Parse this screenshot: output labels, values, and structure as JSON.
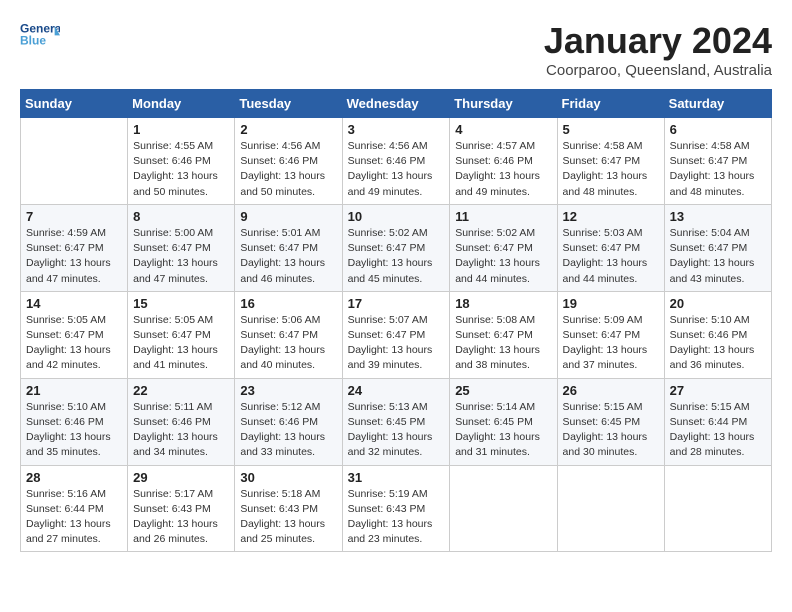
{
  "logo": {
    "general": "General",
    "blue": "Blue"
  },
  "title": "January 2024",
  "location": "Coorparoo, Queensland, Australia",
  "weekdays": [
    "Sunday",
    "Monday",
    "Tuesday",
    "Wednesday",
    "Thursday",
    "Friday",
    "Saturday"
  ],
  "weeks": [
    [
      {
        "day": "",
        "info": ""
      },
      {
        "day": "1",
        "info": "Sunrise: 4:55 AM\nSunset: 6:46 PM\nDaylight: 13 hours\nand 50 minutes."
      },
      {
        "day": "2",
        "info": "Sunrise: 4:56 AM\nSunset: 6:46 PM\nDaylight: 13 hours\nand 50 minutes."
      },
      {
        "day": "3",
        "info": "Sunrise: 4:56 AM\nSunset: 6:46 PM\nDaylight: 13 hours\nand 49 minutes."
      },
      {
        "day": "4",
        "info": "Sunrise: 4:57 AM\nSunset: 6:46 PM\nDaylight: 13 hours\nand 49 minutes."
      },
      {
        "day": "5",
        "info": "Sunrise: 4:58 AM\nSunset: 6:47 PM\nDaylight: 13 hours\nand 48 minutes."
      },
      {
        "day": "6",
        "info": "Sunrise: 4:58 AM\nSunset: 6:47 PM\nDaylight: 13 hours\nand 48 minutes."
      }
    ],
    [
      {
        "day": "7",
        "info": "Sunrise: 4:59 AM\nSunset: 6:47 PM\nDaylight: 13 hours\nand 47 minutes."
      },
      {
        "day": "8",
        "info": "Sunrise: 5:00 AM\nSunset: 6:47 PM\nDaylight: 13 hours\nand 47 minutes."
      },
      {
        "day": "9",
        "info": "Sunrise: 5:01 AM\nSunset: 6:47 PM\nDaylight: 13 hours\nand 46 minutes."
      },
      {
        "day": "10",
        "info": "Sunrise: 5:02 AM\nSunset: 6:47 PM\nDaylight: 13 hours\nand 45 minutes."
      },
      {
        "day": "11",
        "info": "Sunrise: 5:02 AM\nSunset: 6:47 PM\nDaylight: 13 hours\nand 44 minutes."
      },
      {
        "day": "12",
        "info": "Sunrise: 5:03 AM\nSunset: 6:47 PM\nDaylight: 13 hours\nand 44 minutes."
      },
      {
        "day": "13",
        "info": "Sunrise: 5:04 AM\nSunset: 6:47 PM\nDaylight: 13 hours\nand 43 minutes."
      }
    ],
    [
      {
        "day": "14",
        "info": "Sunrise: 5:05 AM\nSunset: 6:47 PM\nDaylight: 13 hours\nand 42 minutes."
      },
      {
        "day": "15",
        "info": "Sunrise: 5:05 AM\nSunset: 6:47 PM\nDaylight: 13 hours\nand 41 minutes."
      },
      {
        "day": "16",
        "info": "Sunrise: 5:06 AM\nSunset: 6:47 PM\nDaylight: 13 hours\nand 40 minutes."
      },
      {
        "day": "17",
        "info": "Sunrise: 5:07 AM\nSunset: 6:47 PM\nDaylight: 13 hours\nand 39 minutes."
      },
      {
        "day": "18",
        "info": "Sunrise: 5:08 AM\nSunset: 6:47 PM\nDaylight: 13 hours\nand 38 minutes."
      },
      {
        "day": "19",
        "info": "Sunrise: 5:09 AM\nSunset: 6:47 PM\nDaylight: 13 hours\nand 37 minutes."
      },
      {
        "day": "20",
        "info": "Sunrise: 5:10 AM\nSunset: 6:46 PM\nDaylight: 13 hours\nand 36 minutes."
      }
    ],
    [
      {
        "day": "21",
        "info": "Sunrise: 5:10 AM\nSunset: 6:46 PM\nDaylight: 13 hours\nand 35 minutes."
      },
      {
        "day": "22",
        "info": "Sunrise: 5:11 AM\nSunset: 6:46 PM\nDaylight: 13 hours\nand 34 minutes."
      },
      {
        "day": "23",
        "info": "Sunrise: 5:12 AM\nSunset: 6:46 PM\nDaylight: 13 hours\nand 33 minutes."
      },
      {
        "day": "24",
        "info": "Sunrise: 5:13 AM\nSunset: 6:45 PM\nDaylight: 13 hours\nand 32 minutes."
      },
      {
        "day": "25",
        "info": "Sunrise: 5:14 AM\nSunset: 6:45 PM\nDaylight: 13 hours\nand 31 minutes."
      },
      {
        "day": "26",
        "info": "Sunrise: 5:15 AM\nSunset: 6:45 PM\nDaylight: 13 hours\nand 30 minutes."
      },
      {
        "day": "27",
        "info": "Sunrise: 5:15 AM\nSunset: 6:44 PM\nDaylight: 13 hours\nand 28 minutes."
      }
    ],
    [
      {
        "day": "28",
        "info": "Sunrise: 5:16 AM\nSunset: 6:44 PM\nDaylight: 13 hours\nand 27 minutes."
      },
      {
        "day": "29",
        "info": "Sunrise: 5:17 AM\nSunset: 6:43 PM\nDaylight: 13 hours\nand 26 minutes."
      },
      {
        "day": "30",
        "info": "Sunrise: 5:18 AM\nSunset: 6:43 PM\nDaylight: 13 hours\nand 25 minutes."
      },
      {
        "day": "31",
        "info": "Sunrise: 5:19 AM\nSunset: 6:43 PM\nDaylight: 13 hours\nand 23 minutes."
      },
      {
        "day": "",
        "info": ""
      },
      {
        "day": "",
        "info": ""
      },
      {
        "day": "",
        "info": ""
      }
    ]
  ]
}
